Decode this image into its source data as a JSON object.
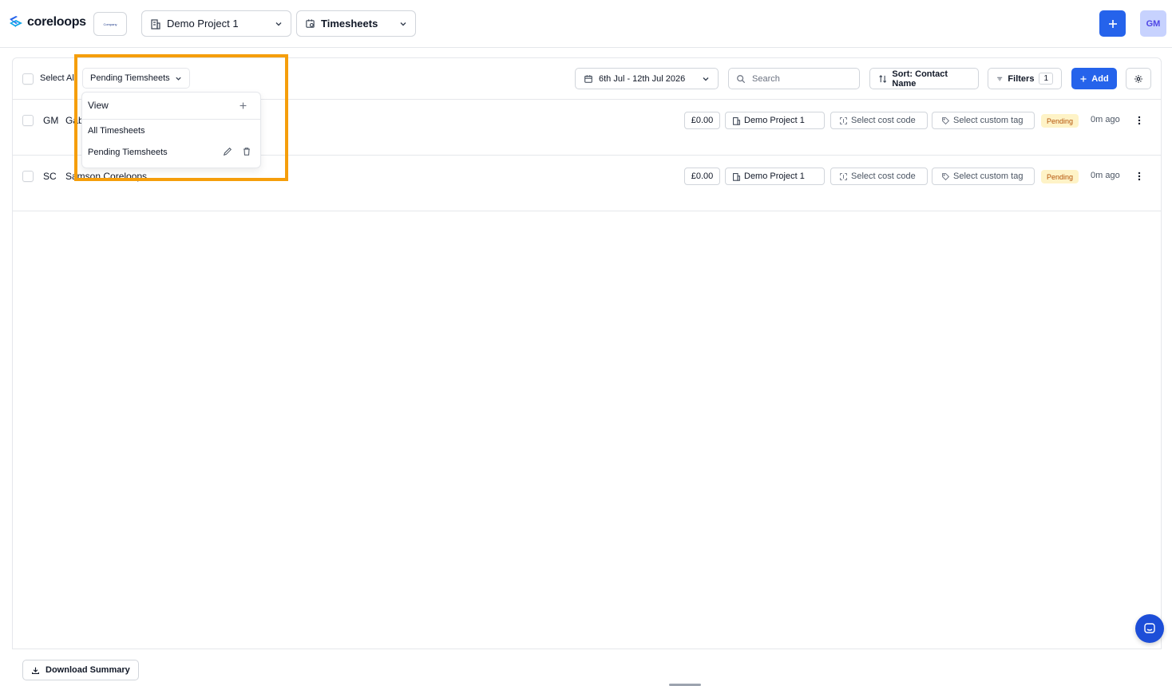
{
  "header": {
    "logo_text": "coreloops",
    "org_logo_text": "Company",
    "project_select": "Demo Project 1",
    "module_select": "Timesheets",
    "avatar_initials": "GM"
  },
  "toolbar": {
    "select_all_label": "Select All",
    "view_select": "Pending Tiemsheets",
    "date_range": "6th Jul - 12th Jul 2026",
    "search_placeholder": "Search",
    "sort_label": "Sort: Contact Name",
    "filters_label": "Filters",
    "filters_count": "1",
    "add_label": "Add"
  },
  "dropdown": {
    "title": "View",
    "items": [
      "All Timesheets",
      "Pending Tiemsheets"
    ]
  },
  "rows": [
    {
      "initials": "GM",
      "name": "Gabriel Morgan",
      "amount": "£0.00",
      "project": "Demo Project 1",
      "cost_code": "Select cost code",
      "custom_tag": "Select custom tag",
      "status": "Pending",
      "ago": "0m ago"
    },
    {
      "initials": "SC",
      "name": "Samson Coreloops",
      "amount": "£0.00",
      "project": "Demo Project 1",
      "cost_code": "Select cost code",
      "custom_tag": "Select custom tag",
      "status": "Pending",
      "ago": "0m ago"
    }
  ],
  "footer": {
    "download_label": "Download Summary"
  },
  "colors": {
    "primary": "#2563eb",
    "highlight": "#f59e0b",
    "pending_bg": "#fef3c7",
    "pending_text": "#b45309"
  }
}
